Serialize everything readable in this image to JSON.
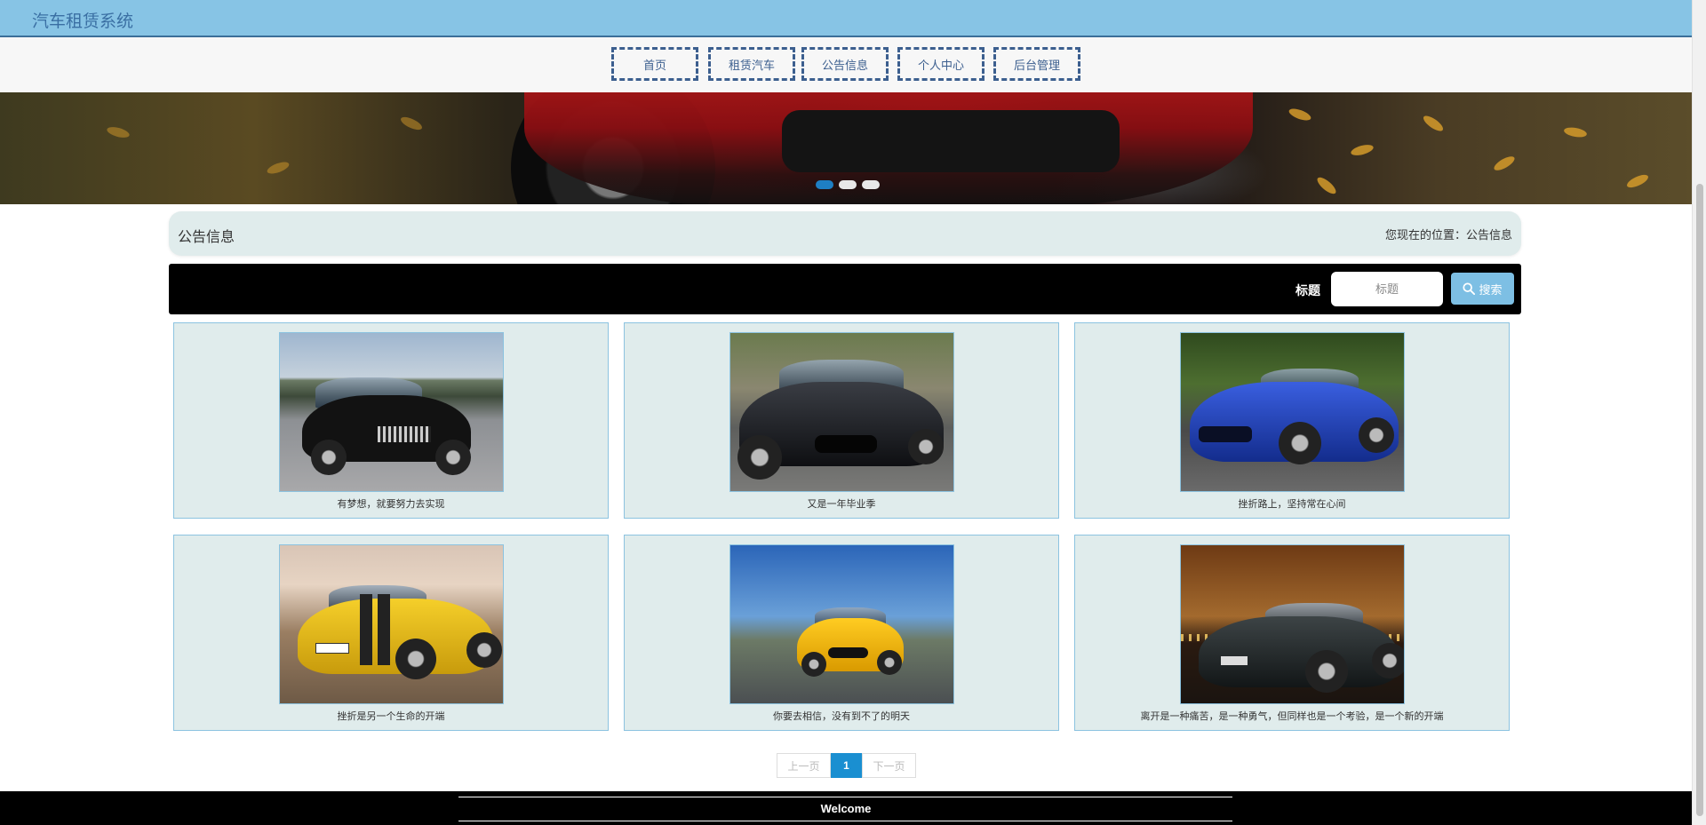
{
  "app": {
    "title": "汽车租赁系统"
  },
  "nav": {
    "items": [
      {
        "label": "首页"
      },
      {
        "label": "租赁汽车"
      },
      {
        "label": "公告信息"
      },
      {
        "label": "个人中心"
      },
      {
        "label": "后台管理"
      }
    ]
  },
  "banner": {
    "slides": 3,
    "active_slide": 1
  },
  "breadcrumb": {
    "title": "公告信息",
    "position": "您现在的位置：公告信息"
  },
  "search": {
    "label": "标题",
    "placeholder": "标题",
    "button_label": "搜索"
  },
  "cards": [
    {
      "caption": "有梦想，就要努力去实现",
      "image": "black-suv-photo"
    },
    {
      "caption": "又是一年毕业季",
      "image": "black-sports-car-photo"
    },
    {
      "caption": "挫折路上，坚持常在心间",
      "image": "blue-sports-car-photo"
    },
    {
      "caption": "挫折是另一个生命的开端",
      "image": "yellow-camaro-photo"
    },
    {
      "caption": "你要去相信，没有到不了的明天",
      "image": "yellow-sports-car-photo"
    },
    {
      "caption": "离开是一种痛苦，是一种勇气，但同样也是一个考验，是一个新的开端",
      "image": "gtr-night-photo"
    }
  ],
  "pagination": {
    "prev_label": "上一页",
    "current": "1",
    "next_label": "下一页"
  },
  "footer": {
    "text": "Welcome"
  },
  "colors": {
    "header_bg": "#87c4e5",
    "accent": "#1a8fd1",
    "card_bg": "#e0ecec",
    "nav_border": "#3c5f8f"
  }
}
